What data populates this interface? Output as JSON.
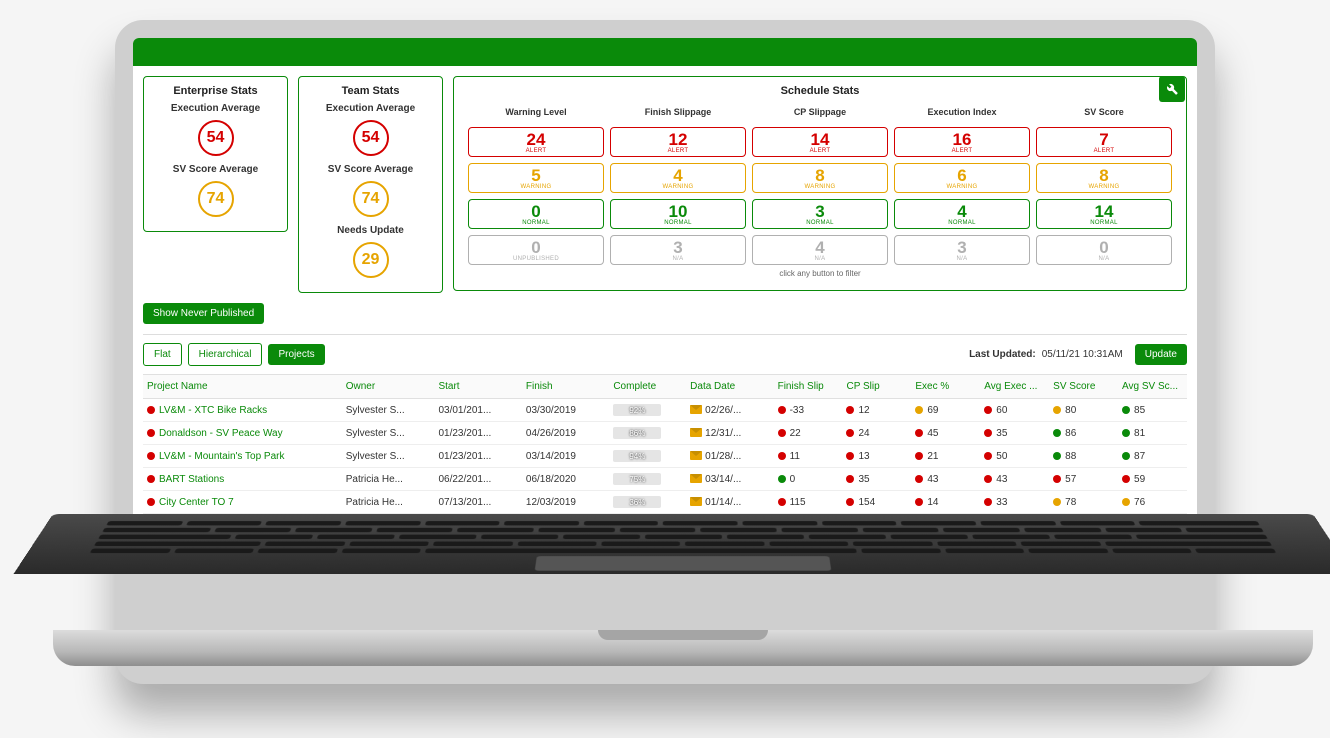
{
  "enterprise": {
    "title": "Enterprise Stats",
    "exec_label": "Execution Average",
    "exec_value": "54",
    "sv_label": "SV Score Average",
    "sv_value": "74"
  },
  "team": {
    "title": "Team Stats",
    "exec_label": "Execution Average",
    "exec_value": "54",
    "sv_label": "SV Score Average",
    "sv_value": "74",
    "needs_label": "Needs Update",
    "needs_value": "29"
  },
  "schedule": {
    "title": "Schedule Stats",
    "hint": "click any button to filter",
    "cols": [
      "Warning Level",
      "Finish Slippage",
      "CP Slippage",
      "Execution Index",
      "SV Score"
    ],
    "rows": [
      {
        "status": "alert",
        "label": "ALERT",
        "vals": [
          "24",
          "12",
          "14",
          "16",
          "7"
        ]
      },
      {
        "status": "warning",
        "label": "WARNING",
        "vals": [
          "5",
          "4",
          "8",
          "6",
          "8"
        ]
      },
      {
        "status": "normal",
        "label": "NORMAL",
        "vals": [
          "0",
          "10",
          "3",
          "4",
          "14"
        ]
      },
      {
        "status": "na",
        "label_first": "UNPUBLISHED",
        "label_rest": "N/A",
        "vals": [
          "0",
          "3",
          "4",
          "3",
          "0"
        ]
      }
    ]
  },
  "buttons": {
    "show_never": "Show Never Published",
    "flat": "Flat",
    "hierarchical": "Hierarchical",
    "projects": "Projects",
    "update": "Update"
  },
  "last_updated_label": "Last Updated:",
  "last_updated_value": "05/11/21 10:31AM",
  "table": {
    "headers": [
      "Project Name",
      "Owner",
      "Start",
      "Finish",
      "Complete",
      "Data Date",
      "Finish Slip",
      "CP Slip",
      "Exec %",
      "Avg Exec ...",
      "SV Score",
      "Avg SV Sc..."
    ],
    "rows": [
      {
        "name": "LV&M - XTC Bike Racks",
        "name_dot": "red",
        "owner": "Sylvester S...",
        "start": "03/01/201...",
        "finish": "03/30/2019",
        "complete": 92,
        "data_date": "02/26/...",
        "finish_slip": {
          "dot": "red",
          "val": "-33"
        },
        "cp_slip": {
          "dot": "red",
          "val": "12"
        },
        "exec": {
          "dot": "orange",
          "val": "69"
        },
        "avg_exec": {
          "dot": "red",
          "val": "60"
        },
        "sv": {
          "dot": "orange",
          "val": "80"
        },
        "avg_sv": {
          "dot": "green",
          "val": "85"
        }
      },
      {
        "name": "Donaldson - SV Peace Way",
        "name_dot": "red",
        "owner": "Sylvester S...",
        "start": "01/23/201...",
        "finish": "04/26/2019",
        "complete": 86,
        "data_date": "12/31/...",
        "finish_slip": {
          "dot": "red",
          "val": "22"
        },
        "cp_slip": {
          "dot": "red",
          "val": "24"
        },
        "exec": {
          "dot": "red",
          "val": "45"
        },
        "avg_exec": {
          "dot": "red",
          "val": "35"
        },
        "sv": {
          "dot": "green",
          "val": "86"
        },
        "avg_sv": {
          "dot": "green",
          "val": "81"
        }
      },
      {
        "name": "LV&M - Mountain's Top Park",
        "name_dot": "red",
        "owner": "Sylvester S...",
        "start": "01/23/201...",
        "finish": "03/14/2019",
        "complete": 94,
        "data_date": "01/28/...",
        "finish_slip": {
          "dot": "red",
          "val": "11"
        },
        "cp_slip": {
          "dot": "red",
          "val": "13"
        },
        "exec": {
          "dot": "red",
          "val": "21"
        },
        "avg_exec": {
          "dot": "red",
          "val": "50"
        },
        "sv": {
          "dot": "green",
          "val": "88"
        },
        "avg_sv": {
          "dot": "green",
          "val": "87"
        }
      },
      {
        "name": "BART Stations",
        "name_dot": "red",
        "owner": "Patricia He...",
        "start": "06/22/201...",
        "finish": "06/18/2020",
        "complete": 75,
        "data_date": "03/14/...",
        "finish_slip": {
          "dot": "green",
          "val": "0"
        },
        "cp_slip": {
          "dot": "red",
          "val": "35"
        },
        "exec": {
          "dot": "red",
          "val": "43"
        },
        "avg_exec": {
          "dot": "red",
          "val": "43"
        },
        "sv": {
          "dot": "red",
          "val": "57"
        },
        "avg_sv": {
          "dot": "red",
          "val": "59"
        }
      },
      {
        "name": "City Center TO 7",
        "name_dot": "red",
        "owner": "Patricia He...",
        "start": "07/13/201...",
        "finish": "12/03/2019",
        "complete": 36,
        "data_date": "01/14/...",
        "finish_slip": {
          "dot": "red",
          "val": "115"
        },
        "cp_slip": {
          "dot": "red",
          "val": "154"
        },
        "exec": {
          "dot": "red",
          "val": "14"
        },
        "avg_exec": {
          "dot": "red",
          "val": "33"
        },
        "sv": {
          "dot": "orange",
          "val": "78"
        },
        "avg_sv": {
          "dot": "orange",
          "val": "76"
        }
      }
    ]
  }
}
